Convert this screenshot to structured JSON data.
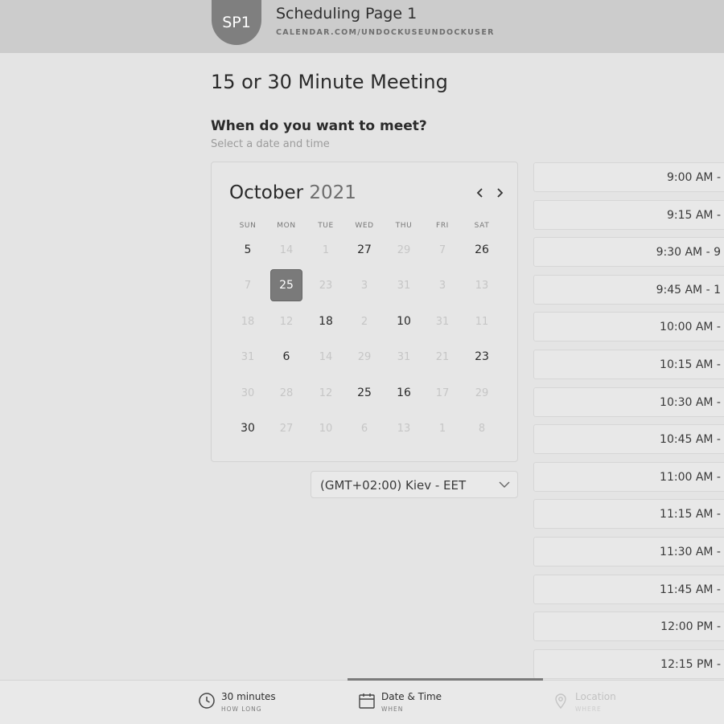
{
  "header": {
    "avatar_initials": "SP1",
    "page_name": "Scheduling Page 1",
    "url": "CALENDAR.COM/UNDOCKUSEUNDOCKUSER"
  },
  "meeting": {
    "title": "15 or 30 Minute Meeting",
    "question": "When do you want to meet?",
    "hint": "Select a date and time"
  },
  "calendar": {
    "month": "October",
    "year": "2021",
    "weekdays": [
      "SUN",
      "MON",
      "TUE",
      "WED",
      "THU",
      "FRI",
      "SAT"
    ],
    "weeks": [
      [
        {
          "d": "5",
          "s": "active"
        },
        {
          "d": "14",
          "s": "disabled"
        },
        {
          "d": "1",
          "s": "disabled"
        },
        {
          "d": "27",
          "s": "active"
        },
        {
          "d": "29",
          "s": "disabled"
        },
        {
          "d": "7",
          "s": "disabled"
        },
        {
          "d": "26",
          "s": "active"
        }
      ],
      [
        {
          "d": "7",
          "s": "disabled"
        },
        {
          "d": "25",
          "s": "selected"
        },
        {
          "d": "23",
          "s": "disabled"
        },
        {
          "d": "3",
          "s": "disabled"
        },
        {
          "d": "31",
          "s": "disabled"
        },
        {
          "d": "3",
          "s": "disabled"
        },
        {
          "d": "13",
          "s": "disabled"
        }
      ],
      [
        {
          "d": "18",
          "s": "disabled"
        },
        {
          "d": "12",
          "s": "disabled"
        },
        {
          "d": "18",
          "s": "active"
        },
        {
          "d": "2",
          "s": "disabled"
        },
        {
          "d": "10",
          "s": "active"
        },
        {
          "d": "31",
          "s": "disabled"
        },
        {
          "d": "11",
          "s": "disabled"
        }
      ],
      [
        {
          "d": "31",
          "s": "disabled"
        },
        {
          "d": "6",
          "s": "active"
        },
        {
          "d": "14",
          "s": "disabled"
        },
        {
          "d": "29",
          "s": "disabled"
        },
        {
          "d": "31",
          "s": "disabled"
        },
        {
          "d": "21",
          "s": "disabled"
        },
        {
          "d": "23",
          "s": "active"
        }
      ],
      [
        {
          "d": "30",
          "s": "disabled"
        },
        {
          "d": "28",
          "s": "disabled"
        },
        {
          "d": "12",
          "s": "disabled"
        },
        {
          "d": "25",
          "s": "active"
        },
        {
          "d": "16",
          "s": "active"
        },
        {
          "d": "17",
          "s": "disabled"
        },
        {
          "d": "29",
          "s": "disabled"
        }
      ],
      [
        {
          "d": "30",
          "s": "active"
        },
        {
          "d": "27",
          "s": "disabled"
        },
        {
          "d": "10",
          "s": "disabled"
        },
        {
          "d": "6",
          "s": "disabled"
        },
        {
          "d": "13",
          "s": "disabled"
        },
        {
          "d": "1",
          "s": "disabled"
        },
        {
          "d": "8",
          "s": "disabled"
        }
      ]
    ]
  },
  "timezone": {
    "label": "(GMT+02:00) Kiev - EET"
  },
  "slots": [
    "9:00 AM -",
    "9:15 AM -",
    "9:30 AM - 9",
    "9:45 AM - 1",
    "10:00 AM -",
    "10:15 AM -",
    "10:30 AM -",
    "10:45 AM -",
    "11:00 AM -",
    "11:15 AM -",
    "11:30 AM -",
    "11:45 AM -",
    "12:00 PM -",
    "12:15 PM -"
  ],
  "steps": [
    {
      "name": "30 minutes",
      "sub": "HOW LONG",
      "icon": "clock-icon",
      "state": "done"
    },
    {
      "name": "Date & Time",
      "sub": "WHEN",
      "icon": "calendar-icon",
      "state": "current"
    },
    {
      "name": "Location",
      "sub": "WHERE",
      "icon": "location-pin-icon",
      "state": "upcoming"
    }
  ],
  "colors": {
    "selected_day": "#7a7a7a",
    "header_bg": "#cccccc",
    "page_bg": "#e4e4e4"
  }
}
